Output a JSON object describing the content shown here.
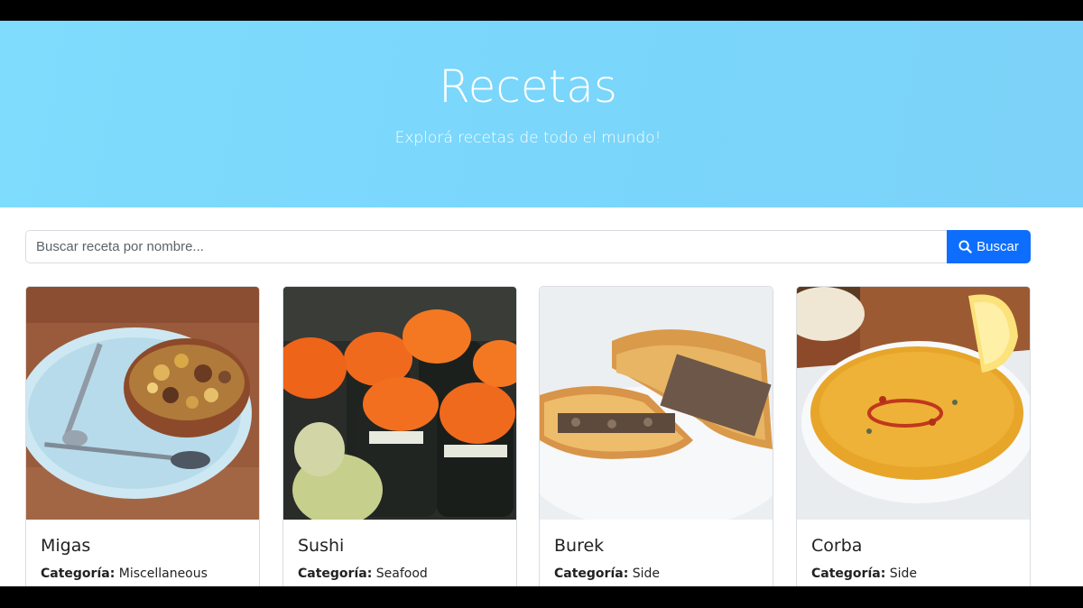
{
  "hero": {
    "title": "Recetas",
    "subtitle": "Explorá recetas de todo el mundo!"
  },
  "search": {
    "placeholder": "Buscar receta por nombre...",
    "button_label": "Buscar",
    "button_icon": "search-icon"
  },
  "cards": [
    {
      "title": "Migas",
      "category_label": "Categoría:",
      "category": "Miscellaneous"
    },
    {
      "title": "Sushi",
      "category_label": "Categoría:",
      "category": "Seafood"
    },
    {
      "title": "Burek",
      "category_label": "Categoría:",
      "category": "Side"
    },
    {
      "title": "Corba",
      "category_label": "Categoría:",
      "category": "Side"
    }
  ],
  "colors": {
    "hero_bg": "#7ad6fb",
    "button_bg": "#0d6efd"
  }
}
